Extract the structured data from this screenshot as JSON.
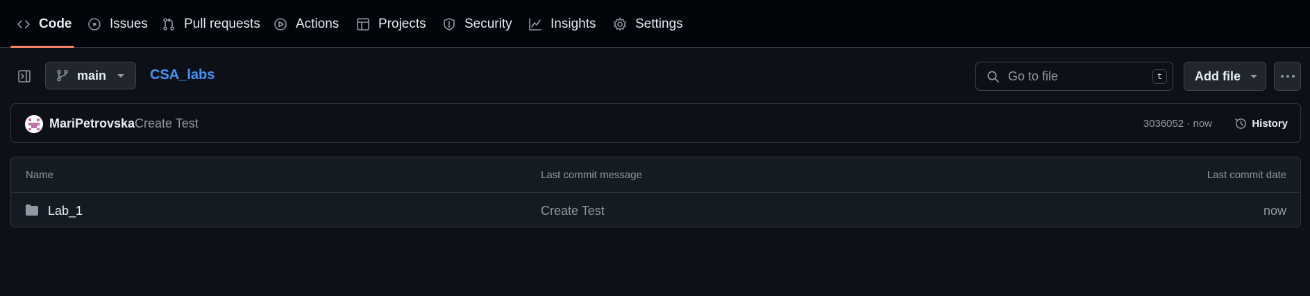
{
  "nav": {
    "tabs": [
      {
        "label": "Code",
        "icon": "code-icon",
        "active": true
      },
      {
        "label": "Issues",
        "icon": "issue-opened-icon"
      },
      {
        "label": "Pull requests",
        "icon": "git-pull-request-icon"
      },
      {
        "label": "Actions",
        "icon": "play-icon"
      },
      {
        "label": "Projects",
        "icon": "table-icon"
      },
      {
        "label": "Security",
        "icon": "shield-icon"
      },
      {
        "label": "Insights",
        "icon": "graph-icon"
      },
      {
        "label": "Settings",
        "icon": "gear-icon"
      }
    ],
    "active_color": "#f78166"
  },
  "toolbar": {
    "sidebar_toggle_icon": "sidebar-expand-icon",
    "branch": "main",
    "repo_name": "CSA_labs",
    "search_placeholder": "Go to file",
    "search_shortcut": "t",
    "add_file_label": "Add file",
    "more_icon": "kebab-horizontal-icon"
  },
  "latest_commit": {
    "author": "MariPetrovska",
    "message": "Create Test",
    "hash_time": "3036052 · now",
    "history_label": "History"
  },
  "files": {
    "columns": [
      "Name",
      "Last commit message",
      "Last commit date"
    ],
    "rows": [
      {
        "name": "Lab_1",
        "type": "folder",
        "message": "Create Test",
        "date": "now"
      }
    ]
  },
  "colors": {
    "background": "#0d1117",
    "nav_background": "#010409",
    "link": "#4493f8",
    "muted": "#9198a1",
    "border": "#30363d"
  }
}
